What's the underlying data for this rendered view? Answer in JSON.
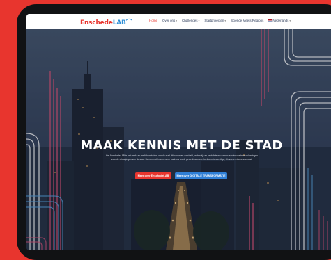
{
  "header": {
    "logo_part1": "Enschede",
    "logo_part2": "LAB",
    "nav": [
      {
        "label": "Home",
        "active": true,
        "dropdown": false
      },
      {
        "label": "Over ons",
        "active": false,
        "dropdown": true
      },
      {
        "label": "Challenges",
        "active": false,
        "dropdown": true
      },
      {
        "label": "Startprojecten",
        "active": false,
        "dropdown": true
      },
      {
        "label": "Science Meets Regions",
        "active": false,
        "dropdown": false
      },
      {
        "label": "Nederlands",
        "active": false,
        "dropdown": true
      }
    ]
  },
  "hero": {
    "title": "MAAK KENNIS MET DE STAD",
    "description": "Het EnschedeLAB is het werk- en testlaboratorium van de stad. Hier werken overheid, onderwijs en bedrijfsleven samen aan innovatieve oplossingen voor de uitdagingen van de stad. Samen met inwoners en partners wordt gewerkt aan een toekomstbestendige, slimme en duurzame stad.",
    "button_primary": "Meer over EnschedeLAB",
    "button_secondary": "Meer over DIGITALE TRANSFORMATIE"
  },
  "colors": {
    "brand_red": "#e8352e",
    "brand_blue": "#2f8fd6",
    "frame": "#111214"
  }
}
